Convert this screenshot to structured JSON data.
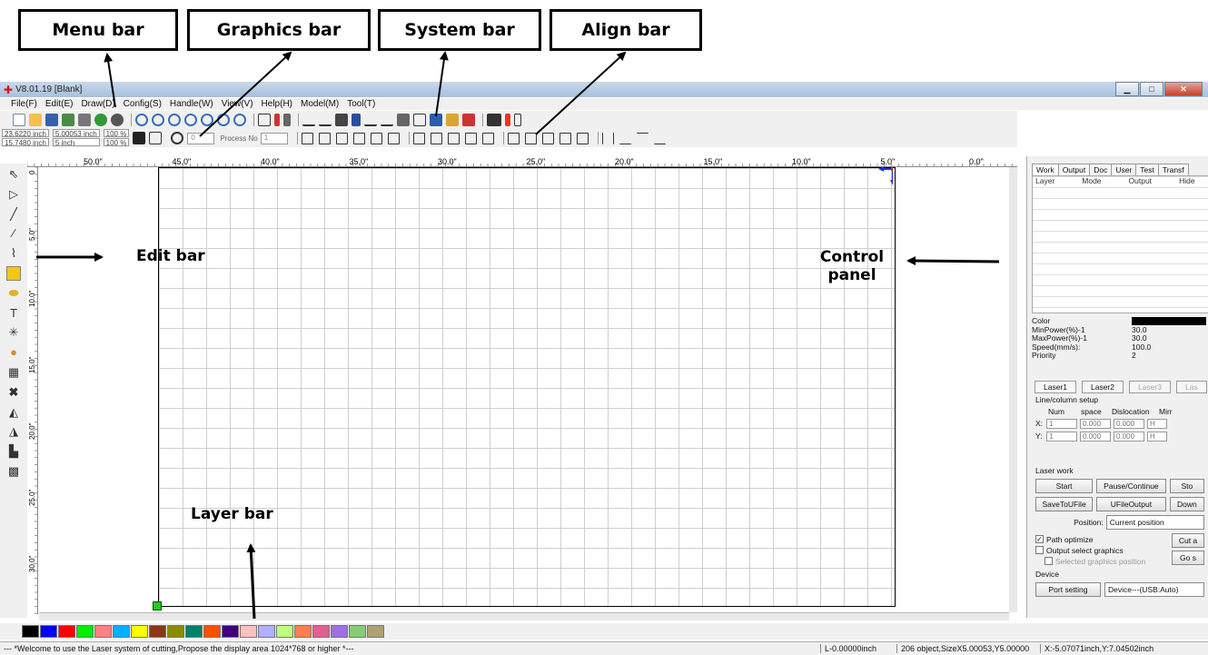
{
  "annotations": {
    "menu_bar": "Menu bar",
    "graphics_bar": "Graphics bar",
    "system_bar": "System bar",
    "align_bar": "Align bar",
    "edit_bar": "Edit bar",
    "control_panel": "Control panel",
    "layer_bar": "Layer bar"
  },
  "window": {
    "title": "V8.01.19 [Blank]"
  },
  "menu": [
    "File(F)",
    "Edit(E)",
    "Draw(D)",
    "Config(S)",
    "Handle(W)",
    "View(V)",
    "Help(H)",
    "Model(M)",
    "Tool(T)"
  ],
  "coords": {
    "x": "23.6220 inch",
    "y": "15.7480 inch",
    "w": "5.00053 inch",
    "h": "5 inch",
    "sx": "100 %",
    "sy": "100 %",
    "rotate": "0",
    "process_no_label": "Process No",
    "process_no": "1"
  },
  "ruler_labels": [
    "50.0\"",
    "45.0\"",
    "40.0\"",
    "35.0\"",
    "30.0\"",
    "25.0\"",
    "20.0\"",
    "15.0\"",
    "10.0\"",
    "5.0\"",
    "0.0\"",
    "5.0\""
  ],
  "vruler_labels": [
    "0",
    "5.0\"",
    "10.0\"",
    "15.0\"",
    "20.0\"",
    "25.0\"",
    "30.0\""
  ],
  "panel": {
    "tabs": [
      "Work",
      "Output",
      "Doc",
      "User",
      "Test",
      "Transf"
    ],
    "layer_headers": [
      "Layer",
      "Mode",
      "Output",
      "Hide"
    ],
    "props": [
      {
        "k": "Color",
        "v": ""
      },
      {
        "k": "MinPower(%)-1",
        "v": "30.0"
      },
      {
        "k": "MaxPower(%)-1",
        "v": "30.0"
      },
      {
        "k": "Speed(mm/s):",
        "v": "100.0"
      },
      {
        "k": "Priority",
        "v": "2"
      }
    ],
    "laser_tabs": [
      "Laser1",
      "Laser2",
      "Laser3",
      "Las"
    ],
    "array_title": "Line/column setup",
    "array_headers": [
      "Num",
      "space",
      "Dislocation",
      "Mirr"
    ],
    "array_x": {
      "label": "X:",
      "num": "1",
      "space": "0.000",
      "disloc": "0.000",
      "mirror": "H"
    },
    "array_y": {
      "label": "Y:",
      "num": "1",
      "space": "0.000",
      "disloc": "0.000",
      "mirror": "H"
    },
    "laserwork_title": "Laser work",
    "buttons_row1": [
      "Start",
      "Pause/Continue",
      "Sto"
    ],
    "buttons_row2": [
      "SaveToUFile",
      "UFileOutput",
      "Down"
    ],
    "position_label": "Position:",
    "position_value": "Current position",
    "path_optimize": "Path optimize",
    "output_select": "Output select graphics",
    "selected_pos": "Selected graphics position",
    "cut_btn": "Cut a",
    "go_btn": "Go s",
    "device_title": "Device",
    "port_setting": "Port setting",
    "device_value": "Device---(USB:Auto)"
  },
  "palette": [
    "#000000",
    "#0000ff",
    "#ff0000",
    "#00ee00",
    "#ff8080",
    "#00b0ff",
    "#ffff00",
    "#8b3a10",
    "#8b8b00",
    "#00806b",
    "#ff5000",
    "#400080",
    "#ffc0c0",
    "#b0b0ff",
    "#c0ff80",
    "#ff8050",
    "#e06090",
    "#a070e0",
    "#80d070",
    "#b0a070"
  ],
  "status": {
    "message": "--- *Welcome to use the Laser system of cutting,Propose the display area 1024*768 or higher *---",
    "l": "L-0.00000inch",
    "objects": "206 object,SizeX5.00053,Y5.00000",
    "xy": "X:-5.07071inch,Y:7.04502inch"
  }
}
